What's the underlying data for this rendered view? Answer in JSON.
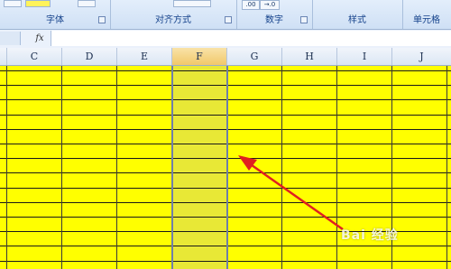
{
  "ribbon": {
    "groups": [
      {
        "label": "字体"
      },
      {
        "label": "对齐方式"
      },
      {
        "label": "数字"
      },
      {
        "label": "样式"
      },
      {
        "label": "单元格"
      }
    ],
    "number_buttons": [
      ".00",
      "→.0"
    ]
  },
  "formula_bar": {
    "fx_label": "fx",
    "value": ""
  },
  "sheet": {
    "columns": [
      "C",
      "D",
      "E",
      "F",
      "G",
      "H",
      "I",
      "J"
    ],
    "selected_column": "F",
    "fill_color": "#ffff00",
    "selection_color": "#e6e65a"
  },
  "annotation": {
    "arrow_color": "#e02020"
  },
  "watermark": "Bai 经验"
}
